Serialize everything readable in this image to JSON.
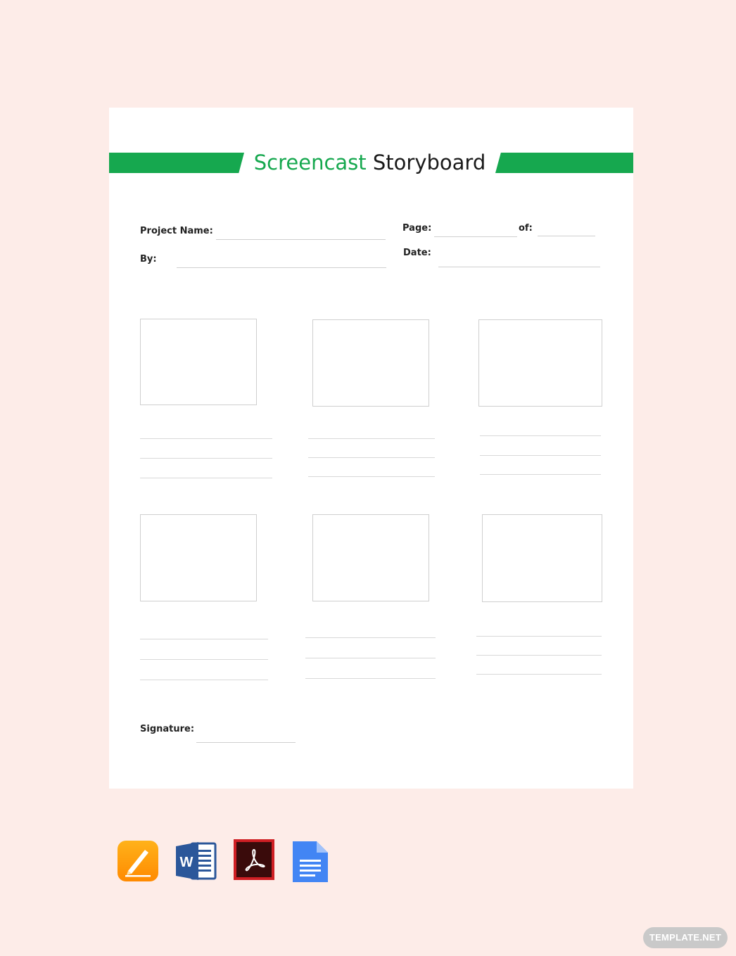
{
  "document": {
    "title_accent": "Screencast",
    "title_rest": "Storyboard",
    "accent_color": "#16a84f",
    "fields": {
      "project_name": "Project Name:",
      "by": "By:",
      "page": "Page:",
      "of": "of:",
      "date": "Date:",
      "signature": "Signature:"
    },
    "frame_count": 6,
    "note_lines_per_frame": 3
  },
  "format_icons": [
    "pages-icon",
    "word-icon",
    "acrobat-pdf-icon",
    "google-docs-icon"
  ],
  "watermark": "TEMPLATE.NET"
}
